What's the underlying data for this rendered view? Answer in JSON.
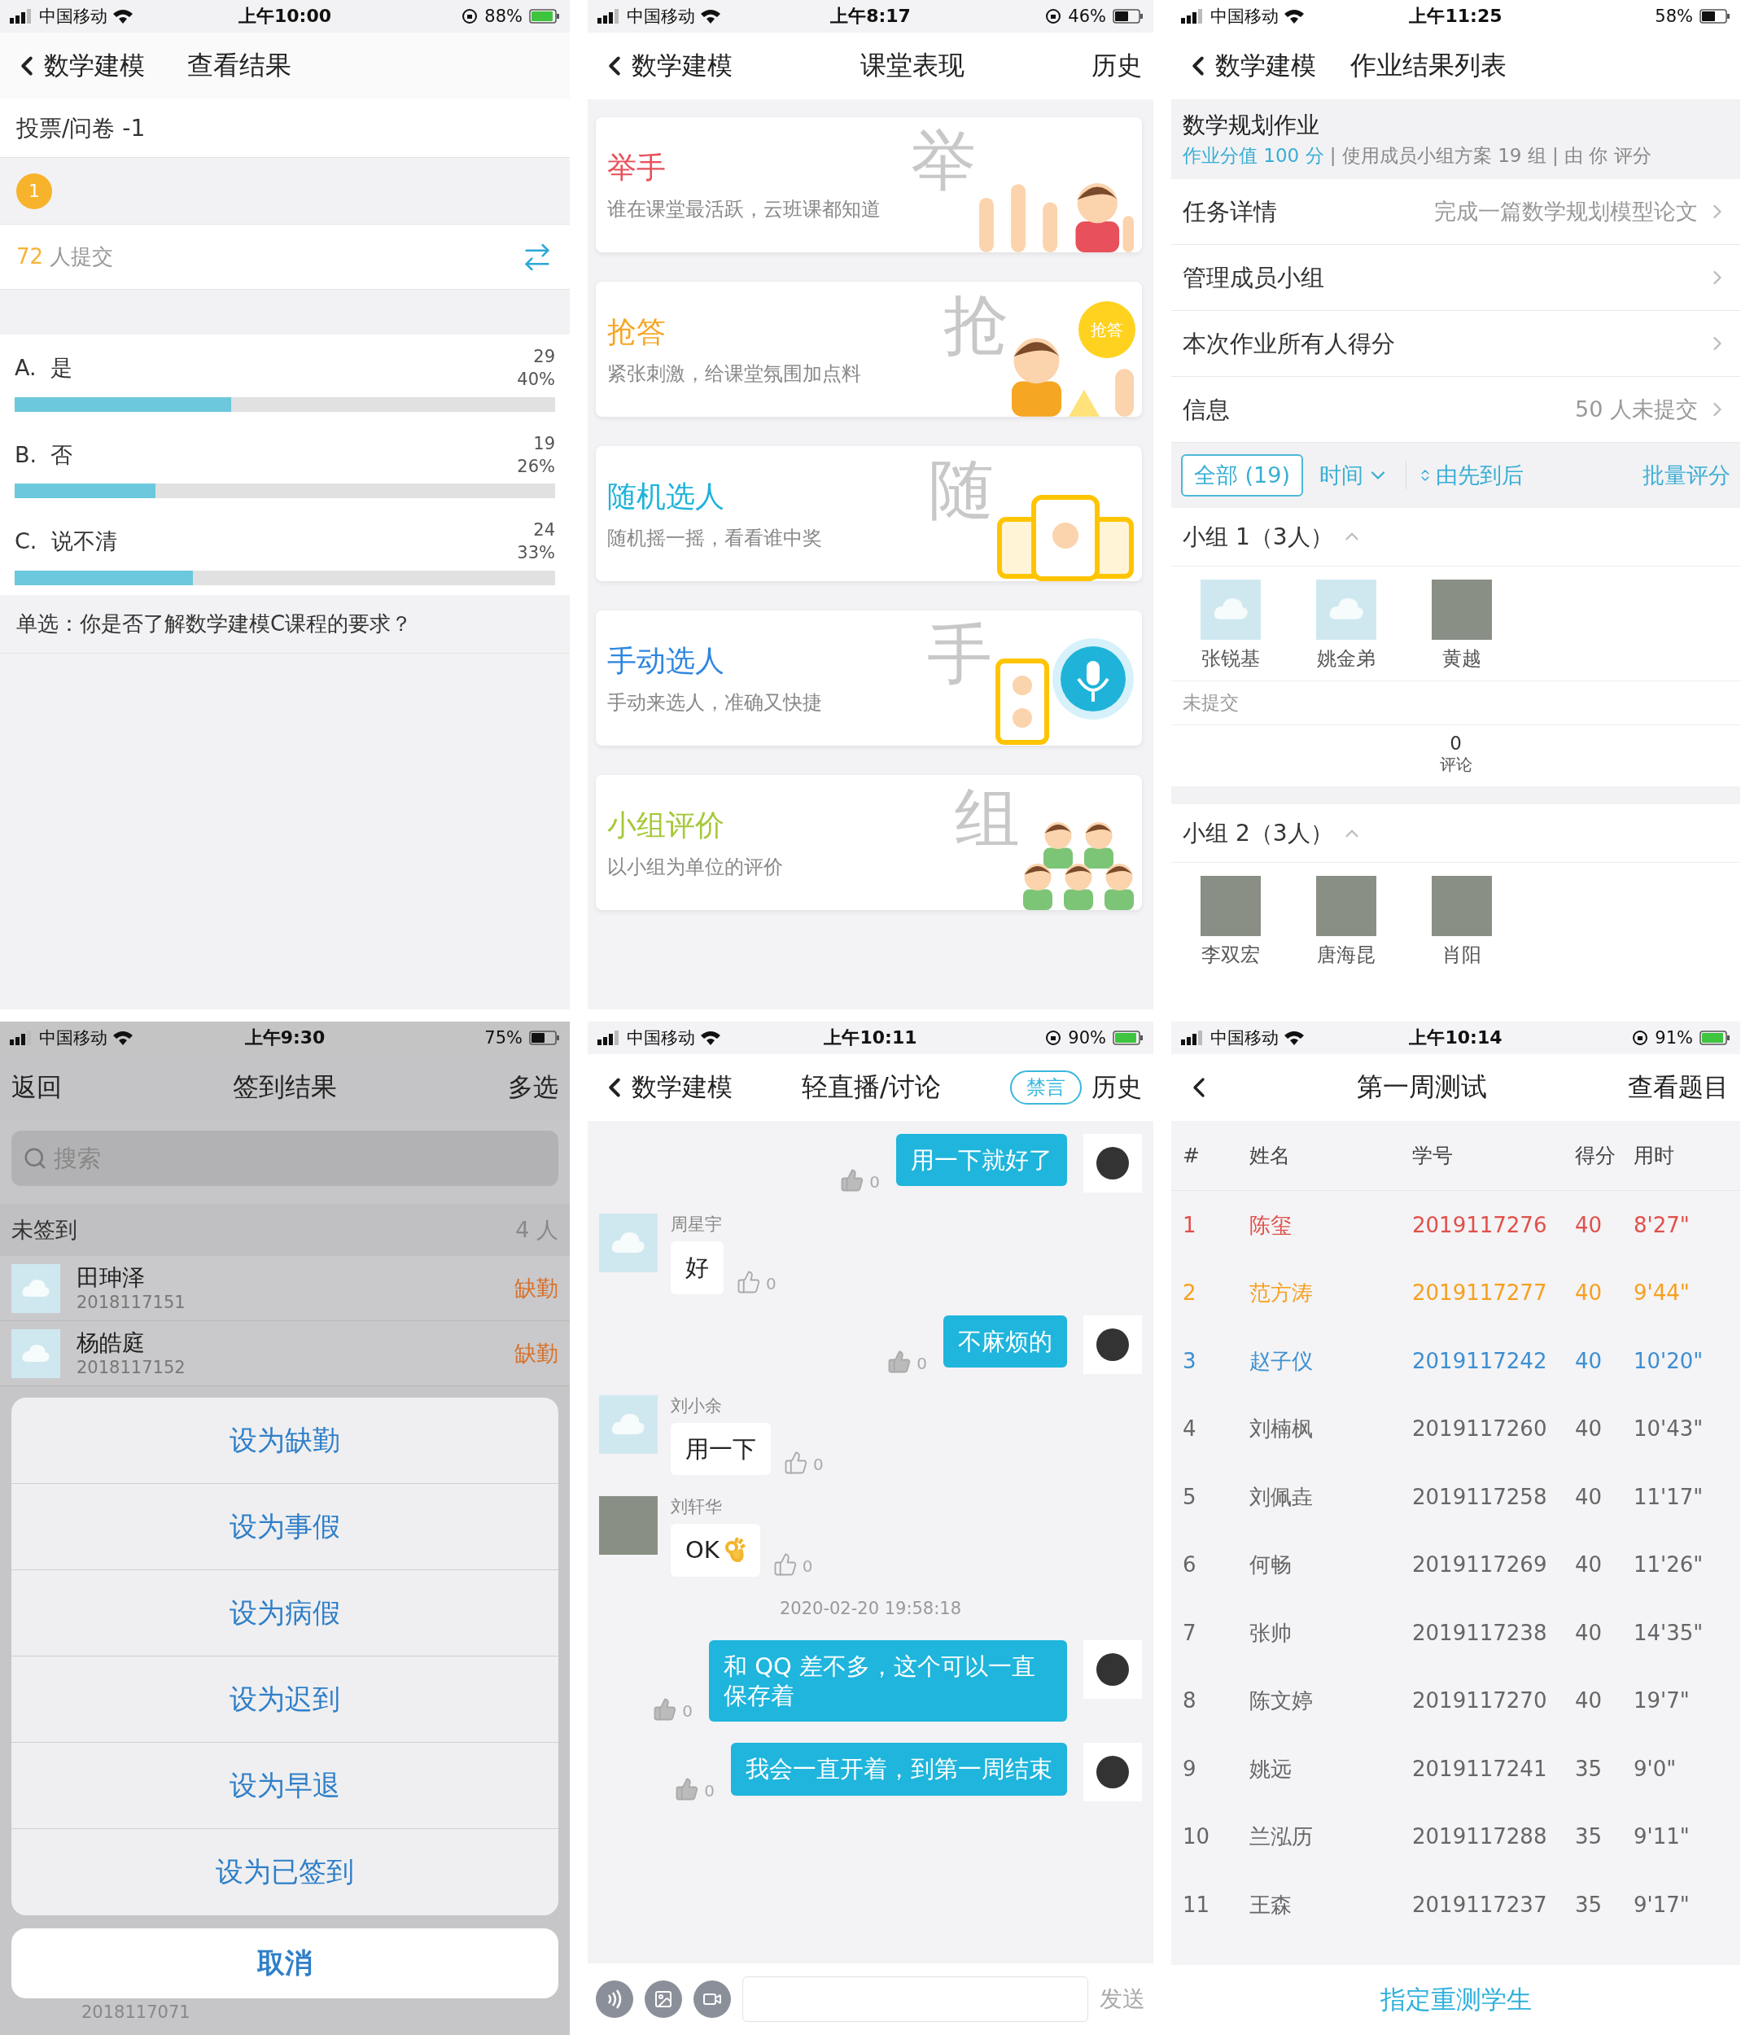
{
  "screens": [
    {
      "kind": "vote",
      "status": {
        "carrier": "中国移动",
        "time": "上午10:00",
        "battery": "88%",
        "charging": true,
        "rotation_lock": true
      },
      "nav": {
        "back": "数学建模",
        "title": "查看结果"
      },
      "survey_title": "投票/问卷 -1",
      "step": "1",
      "submitted": {
        "count": "72",
        "label": "人提交"
      },
      "options": [
        {
          "label": "A.",
          "text": "是",
          "count": "29",
          "percent": "40%",
          "level": 0.4
        },
        {
          "label": "B.",
          "text": "否",
          "count": "19",
          "percent": "26%",
          "level": 0.26
        },
        {
          "label": "C.",
          "text": "说不清",
          "count": "24",
          "percent": "33%",
          "level": 0.33
        }
      ],
      "question": "单选：你是否了解数学建模C课程的要求？"
    },
    {
      "kind": "classroom",
      "status": {
        "carrier": "中国移动",
        "time": "上午8:17",
        "battery": "46%",
        "charging": false,
        "rotation_lock": true
      },
      "nav": {
        "back": "数学建模",
        "title": "课堂表现",
        "right": "历史"
      },
      "cards": [
        {
          "kind": "hands",
          "title": "举手",
          "subtitle": "谁在课堂最活跃，云班课都知道",
          "watermark": "举",
          "color": "#e8505b"
        },
        {
          "kind": "quiz",
          "title": "抢答",
          "subtitle": "紧张刺激，给课堂氛围加点料",
          "watermark": "抢",
          "badge": "抢答",
          "color": "#f5a623"
        },
        {
          "kind": "random",
          "title": "随机选人",
          "subtitle": "随机摇一摇，看看谁中奖",
          "watermark": "随",
          "color": "#1fb3d9"
        },
        {
          "kind": "manual",
          "title": "手动选人",
          "subtitle": "手动来选人，准确又快捷",
          "watermark": "手",
          "color": "#2f86e0"
        },
        {
          "kind": "group",
          "title": "小组评价",
          "subtitle": "以小组为单位的评价",
          "watermark": "组",
          "color": "#a5c83a"
        }
      ]
    },
    {
      "kind": "homework",
      "status": {
        "carrier": "中国移动",
        "time": "上午11:25",
        "battery": "58%",
        "charging": false,
        "rotation_lock": false
      },
      "nav": {
        "back": "数学建模",
        "title": "作业结果列表"
      },
      "header": {
        "title": "数学规划作业",
        "score": "作业分值 100 分",
        "meta": "| 使用成员小组方案 19 组 | 由 你 评分"
      },
      "rows": [
        {
          "label": "任务详情",
          "value": "完成一篇数学规划模型论文"
        },
        {
          "label": "管理成员小组"
        },
        {
          "label": "本次作业所有人得分"
        },
        {
          "label": "信息",
          "value": "50 人未提交"
        }
      ],
      "filters": {
        "all": "全部 (19)",
        "time": "时间",
        "order": "由先到后",
        "batch": "批量评分"
      },
      "groups": [
        {
          "title": "小组 1（3人）",
          "expanded": true,
          "members": [
            {
              "name": "张锐基",
              "photo_avatar": false
            },
            {
              "name": "姚金弟",
              "photo_avatar": false
            },
            {
              "name": "黄越",
              "photo_avatar": true
            }
          ],
          "not_submitted": "未提交",
          "comments_count": "0",
          "comments_label": "评论"
        },
        {
          "title": "小组 2（3人）",
          "expanded": true,
          "members": [
            {
              "name": "李双宏",
              "photo_avatar": true
            },
            {
              "name": "唐海昆",
              "photo_avatar": true
            },
            {
              "name": "肖阳",
              "photo_avatar": true
            }
          ]
        }
      ]
    },
    {
      "kind": "checkin",
      "status": {
        "carrier": "中国移动",
        "time": "上午9:30",
        "battery": "75%",
        "charging": false,
        "rotation_lock": false
      },
      "nav": {
        "left": "返回",
        "title": "签到结果",
        "right": "多选"
      },
      "search": {
        "placeholder": "搜索"
      },
      "section": {
        "title": "未签到",
        "count": "4 人"
      },
      "students": [
        {
          "name": "田珅泽",
          "id": "2018117151",
          "status": "缺勤"
        },
        {
          "name": "杨皓庭",
          "id": "2018117152",
          "status": "缺勤"
        }
      ],
      "actions": [
        "设为缺勤",
        "设为事假",
        "设为病假",
        "设为迟到",
        "设为早退",
        "设为已签到"
      ],
      "cancel": "取消",
      "peek_id": "2018117071"
    },
    {
      "kind": "discussion",
      "status": {
        "carrier": "中国移动",
        "time": "上午10:11",
        "battery": "90%",
        "charging": true,
        "rotation_lock": true
      },
      "nav": {
        "back": "数学建模",
        "title": "轻直播/讨论",
        "mute": "禁言",
        "right": "历史"
      },
      "messages": [
        {
          "kind": "mine",
          "text": "用一下就好了",
          "likes": "0"
        },
        {
          "kind": "other",
          "sender": "周星宇",
          "photo_avatar": false,
          "text": "好",
          "ok_hand": false,
          "likes": "0"
        },
        {
          "kind": "mine",
          "text": "不麻烦的",
          "likes": "0"
        },
        {
          "kind": "other",
          "sender": "刘小余",
          "photo_avatar": false,
          "text": "用一下",
          "ok_hand": false,
          "likes": "0"
        },
        {
          "kind": "other",
          "sender": "刘轩华",
          "photo_avatar": true,
          "text": "OK",
          "ok_hand": true,
          "likes": "0"
        },
        {
          "kind": "time",
          "text": "2020-02-20 19:58:18"
        },
        {
          "kind": "mine",
          "text": "和 QQ 差不多，这个可以一直保存着",
          "likes": "0"
        },
        {
          "kind": "mine",
          "text": "我会一直开着，到第一周结束",
          "likes": "0"
        }
      ],
      "send": "发送"
    },
    {
      "kind": "quiz",
      "status": {
        "carrier": "中国移动",
        "time": "上午10:14",
        "battery": "91%",
        "charging": true,
        "rotation_lock": true
      },
      "nav": {
        "title": "第一周测试",
        "right": "查看题目"
      },
      "columns": [
        "#",
        "姓名",
        "学号",
        "得分",
        "用时"
      ],
      "rows": [
        {
          "cells": [
            "1",
            "陈玺",
            "2019117276",
            "40",
            "8'27\""
          ],
          "color": "#e0504a"
        },
        {
          "cells": [
            "2",
            "范方涛",
            "2019117277",
            "40",
            "9'44\""
          ],
          "color": "#f5a020"
        },
        {
          "cells": [
            "3",
            "赵子仪",
            "2019117242",
            "40",
            "10'20\""
          ],
          "color": "#3d8fd1"
        },
        {
          "cells": [
            "4",
            "刘楠枫",
            "2019117260",
            "40",
            "10'43\""
          ],
          "color": "#666666"
        },
        {
          "cells": [
            "5",
            "刘佩垚",
            "2019117258",
            "40",
            "11'17\""
          ],
          "color": "#666666"
        },
        {
          "cells": [
            "6",
            "何畅",
            "2019117269",
            "40",
            "11'26\""
          ],
          "color": "#666666"
        },
        {
          "cells": [
            "7",
            "张帅",
            "2019117238",
            "40",
            "14'35\""
          ],
          "color": "#666666"
        },
        {
          "cells": [
            "8",
            "陈文婷",
            "2019117270",
            "40",
            "19'7\""
          ],
          "color": "#666666"
        },
        {
          "cells": [
            "9",
            "姚远",
            "2019117241",
            "35",
            "9'0\""
          ],
          "color": "#666666"
        },
        {
          "cells": [
            "10",
            "兰泓历",
            "2019117288",
            "35",
            "9'11\""
          ],
          "color": "#666666"
        },
        {
          "cells": [
            "11",
            "王森",
            "2019117237",
            "35",
            "9'17\""
          ],
          "color": "#666666"
        }
      ],
      "footer": "指定重测学生"
    }
  ]
}
